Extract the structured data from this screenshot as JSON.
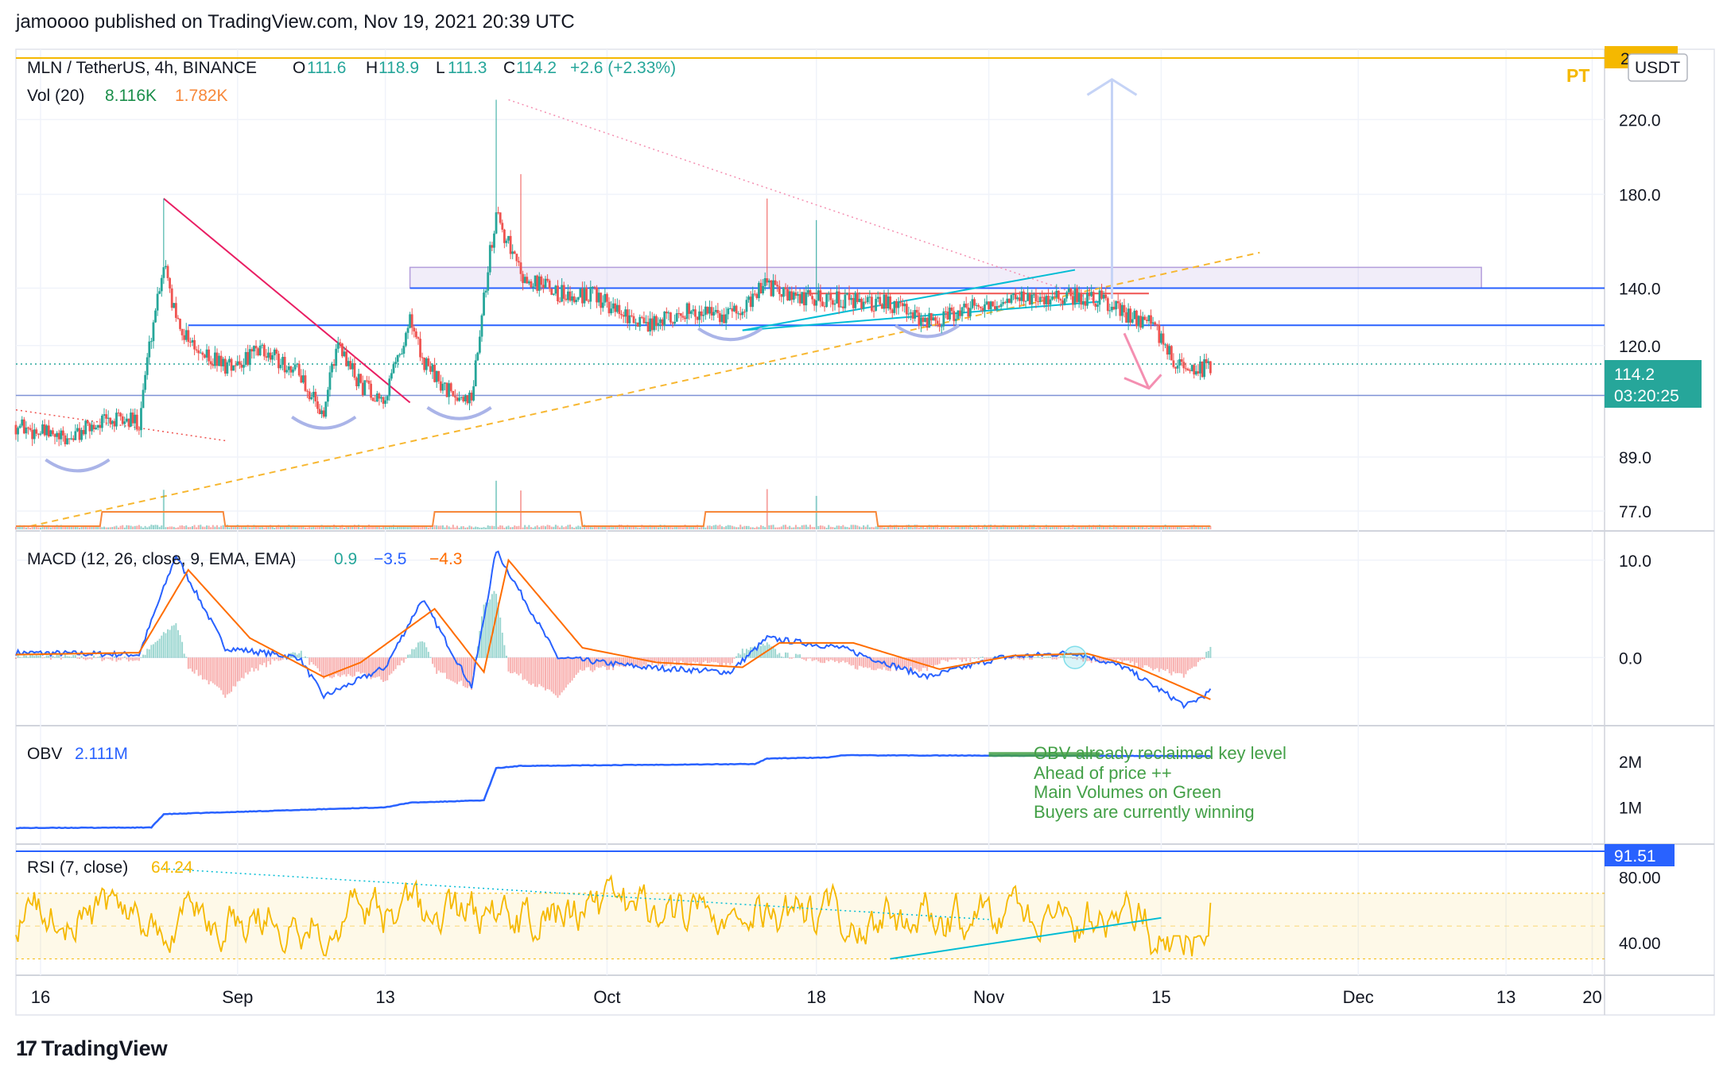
{
  "publisher_line": "jamoooo published on TradingView.com, Nov 19, 2021 20:39 UTC",
  "footer_brand": "TradingView",
  "colors": {
    "up": "#26a69a",
    "down": "#ef5350",
    "macd": "#2962ff",
    "signal": "#ff6d00",
    "rsi": "#f5b800",
    "obv": "#2962ff",
    "grid": "#f0f3fa",
    "level": "#2962ff",
    "annotation": "#43a047"
  },
  "legend": {
    "symbol": "MLN / TetherUS, 4h, BINANCE",
    "o_label": "O",
    "o": "111.6",
    "h_label": "H",
    "h": "118.9",
    "l_label": "L",
    "l": "111.3",
    "c_label": "C",
    "c": "114.2",
    "chg": "+2.6 (+2.33%)",
    "vol_label": "Vol (20)",
    "vol1": "8.116K",
    "vol2": "1.782K"
  },
  "macd_legend": {
    "label": "MACD (12, 26, close, 9, EMA, EMA)",
    "v1": "0.9",
    "v2": "−3.5",
    "v3": "−4.3"
  },
  "obv_legend": {
    "label": "OBV",
    "v": "2.111M"
  },
  "rsi_legend": {
    "label": "RSI (7, close)",
    "v": "64.24"
  },
  "price_badge": {
    "price": "114.2",
    "timer": "03:20:25"
  },
  "top_badge": "2",
  "currency": "USDT",
  "pt_label": "PT",
  "rsi_badge": "91.51",
  "obv_note": [
    "OBV already reclaimed key level",
    "Ahead of price ++",
    "Main Volumes on Green",
    "Buyers are currently winning"
  ],
  "chart_data": [
    {
      "type": "candlestick",
      "title": "MLN / TetherUS, 4h, BINANCE",
      "yscale": "log",
      "ylim": [
        73,
        260
      ],
      "yticks": [
        77.0,
        89.0,
        120.0,
        140.0,
        180.0,
        220.0
      ],
      "x_ticks": [
        "16",
        "Sep",
        "13",
        "Oct",
        "18",
        "Nov",
        "15",
        "Dec",
        "13",
        "20"
      ],
      "x_tick_dates": [
        "2021-08-16",
        "2021-09-01",
        "2021-09-13",
        "2021-10-01",
        "2021-10-18",
        "2021-11-01",
        "2021-11-15",
        "2021-12-01",
        "2021-12-13",
        "2021-12-20"
      ],
      "date_range": [
        "2021-08-14",
        "2021-12-21"
      ],
      "last_date": "2021-11-19",
      "series": [
        {
          "name": "close",
          "dates": [
            "2021-08-14",
            "2021-08-18",
            "2021-08-21",
            "2021-08-24",
            "2021-08-26",
            "2021-08-27",
            "2021-08-29",
            "2021-08-31",
            "2021-09-03",
            "2021-09-06",
            "2021-09-08",
            "2021-09-09",
            "2021-09-11",
            "2021-09-13",
            "2021-09-15",
            "2021-09-16",
            "2021-09-18",
            "2021-09-20",
            "2021-09-22",
            "2021-09-24",
            "2021-09-27",
            "2021-09-30",
            "2021-10-04",
            "2021-10-08",
            "2021-10-11",
            "2021-10-14",
            "2021-10-16",
            "2021-10-20",
            "2021-10-24",
            "2021-10-27",
            "2021-10-30",
            "2021-11-02",
            "2021-11-05",
            "2021-11-08",
            "2021-11-10",
            "2021-11-12",
            "2021-11-14",
            "2021-11-16",
            "2021-11-18",
            "2021-11-19"
          ],
          "values": [
            97,
            93,
            98,
            98,
            150,
            128,
            117,
            114,
            118,
            112,
            98,
            120,
            108,
            104,
            128,
            115,
            106,
            104,
            170,
            145,
            138,
            137,
            127,
            132,
            130,
            141,
            136,
            136,
            134,
            128,
            132,
            136,
            135,
            137,
            136,
            131,
            128,
            116,
            112,
            114.2
          ]
        }
      ],
      "volume_ma_label": "Vol (20)",
      "levels": [
        140.0,
        126.7,
        105.0,
        114.2
      ]
    },
    {
      "type": "line",
      "title": "MACD (12, 26, close, 9, EMA, EMA)",
      "ylim": [
        -7,
        13
      ],
      "yticks": [
        0.0,
        10.0
      ],
      "series": [
        {
          "name": "MACD",
          "dates": [
            "2021-08-14",
            "2021-08-24",
            "2021-08-27",
            "2021-08-31",
            "2021-09-06",
            "2021-09-08",
            "2021-09-13",
            "2021-09-16",
            "2021-09-20",
            "2021-09-22",
            "2021-09-27",
            "2021-10-04",
            "2021-10-11",
            "2021-10-14",
            "2021-10-20",
            "2021-10-27",
            "2021-11-02",
            "2021-11-08",
            "2021-11-12",
            "2021-11-17",
            "2021-11-19"
          ],
          "values": [
            0.5,
            0.3,
            10.5,
            1,
            0,
            -4,
            -1,
            6,
            -3,
            11,
            0,
            -1,
            -1.5,
            2,
            1,
            -2,
            0,
            0.5,
            -1,
            -5,
            -3.5
          ]
        },
        {
          "name": "Signal",
          "dates": [
            "2021-08-14",
            "2021-08-24",
            "2021-08-28",
            "2021-09-02",
            "2021-09-08",
            "2021-09-11",
            "2021-09-17",
            "2021-09-21",
            "2021-09-23",
            "2021-09-29",
            "2021-10-05",
            "2021-10-12",
            "2021-10-15",
            "2021-10-21",
            "2021-10-28",
            "2021-11-03",
            "2021-11-09",
            "2021-11-13",
            "2021-11-19"
          ],
          "values": [
            0.3,
            0.5,
            9,
            2,
            -2,
            -0.5,
            5,
            -1.5,
            10,
            1,
            -0.5,
            -1,
            1.5,
            1.5,
            -1.2,
            0.2,
            0.4,
            -1,
            -4.3
          ]
        }
      ]
    },
    {
      "type": "line",
      "title": "OBV",
      "ylim": [
        200000,
        2600000
      ],
      "yticks": [
        "1M",
        "2M"
      ],
      "series": [
        {
          "name": "OBV",
          "dates": [
            "2021-08-14",
            "2021-08-25",
            "2021-08-26",
            "2021-09-13",
            "2021-09-15",
            "2021-09-21",
            "2021-09-22",
            "2021-09-24",
            "2021-10-13",
            "2021-10-14",
            "2021-10-19",
            "2021-10-20",
            "2021-11-19"
          ],
          "values": [
            550000,
            560000,
            850000,
            1000000,
            1100000,
            1150000,
            1850000,
            1900000,
            1940000,
            2060000,
            2080000,
            2130000,
            2111000
          ]
        }
      ]
    },
    {
      "type": "line",
      "title": "RSI (7, close)",
      "ylim": [
        20,
        100
      ],
      "yticks": [
        40.0,
        80.0
      ],
      "bands": [
        30,
        70
      ],
      "series": [
        {
          "name": "RSI",
          "last": 64.24
        }
      ]
    }
  ]
}
